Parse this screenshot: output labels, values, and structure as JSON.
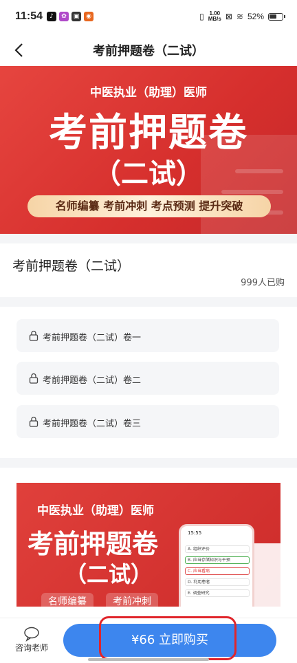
{
  "status_bar": {
    "time": "11:54",
    "speed_top": "1.00",
    "speed_unit": "MB/s",
    "battery": "52%"
  },
  "nav": {
    "title": "考前押题卷（二试）",
    "back_icon": "back-chevron-icon"
  },
  "hero": {
    "subtitle": "中医执业（助理）医师",
    "title": "考前押题卷",
    "title2": "（二试）",
    "tags": "名师编纂  考前冲刺  考点预测  提升突破"
  },
  "product": {
    "title": "考前押题卷（二试）",
    "purchased": "999人已购"
  },
  "papers": [
    {
      "label": "考前押题卷（二试）卷一"
    },
    {
      "label": "考前押题卷（二试）卷二"
    },
    {
      "label": "考前押题卷（二试）卷三"
    }
  ],
  "promo": {
    "subtitle": "中医执业（助理）医师",
    "title": "考前押题卷",
    "title2": "（二试）",
    "tag1": "名师编纂",
    "tag2": "考前冲刺",
    "phone_time": "15:55",
    "phone_rows": [
      "A. 组织评价",
      "B. 应当存储知识与干预",
      "C. 应当看病",
      "D. 利用患者",
      "E. 调查研究"
    ]
  },
  "bottom": {
    "consult_label": "咨询老师",
    "buy_label": "¥66 立即购买"
  },
  "colors": {
    "accent": "#3d86ee",
    "hero_red": "#d62f2d",
    "highlight": "#e0252b"
  }
}
